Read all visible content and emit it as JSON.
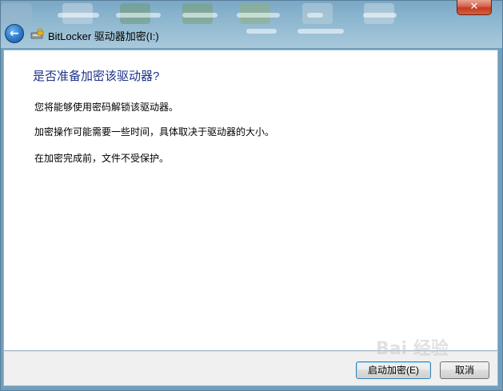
{
  "window": {
    "title": "BitLocker 驱动器加密(I:)",
    "close_glyph": "✕"
  },
  "nav": {
    "back_glyph": "←"
  },
  "content": {
    "heading": "是否准备加密该驱动器?",
    "paragraphs": [
      "您将能够使用密码解锁该驱动器。",
      "加密操作可能需要一些时间，具体取决于驱动器的大小。",
      "在加密完成前，文件不受保护。"
    ]
  },
  "buttons": {
    "start_label": "启动加密(E)",
    "cancel_label": "取消"
  },
  "watermark": "Bai 经验",
  "icons": [
    "back-arrow-icon",
    "bitlocker-drive-icon",
    "close-icon"
  ],
  "colors": {
    "heading": "#1e3287",
    "close_button": "#c23c22",
    "back_button": "#2d78c9"
  }
}
